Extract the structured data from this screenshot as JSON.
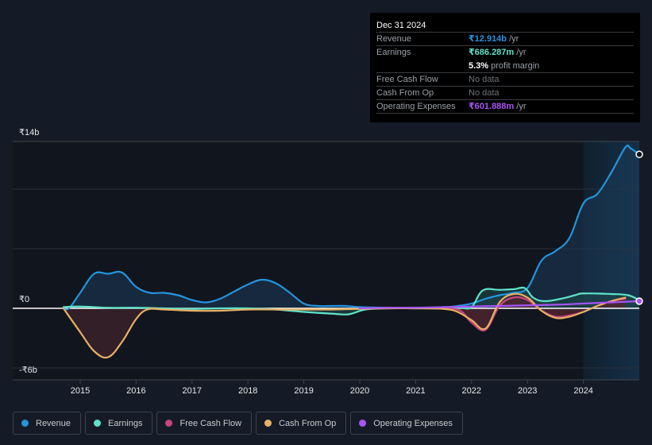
{
  "tooltip": {
    "date": "Dec 31 2024",
    "rows": [
      {
        "label": "Revenue",
        "value": "₹12.914b",
        "unit": " /yr",
        "color": "#2394df"
      },
      {
        "label": "Earnings",
        "value": "₹686.287m",
        "unit": " /yr",
        "color": "#5ee2c9"
      },
      {
        "label": "",
        "margin_value": "5.3%",
        "margin_text": " profit margin"
      },
      {
        "label": "Free Cash Flow",
        "value": "No data"
      },
      {
        "label": "Cash From Op",
        "value": "No data"
      },
      {
        "label": "Operating Expenses",
        "value": "₹601.888m",
        "unit": " /yr",
        "color": "#a855f7"
      }
    ]
  },
  "legend": [
    {
      "label": "Revenue",
      "color": "#2394df"
    },
    {
      "label": "Earnings",
      "color": "#5ee2c9"
    },
    {
      "label": "Free Cash Flow",
      "color": "#c7457f"
    },
    {
      "label": "Cash From Op",
      "color": "#e8b064"
    },
    {
      "label": "Operating Expenses",
      "color": "#a855f7"
    }
  ],
  "chart_data": {
    "type": "area",
    "title": "",
    "xlabel": "",
    "ylabel": "",
    "currency": "₹",
    "ylim": [
      -6,
      14
    ],
    "y_unit": "b",
    "y_tick_labels": [
      "₹14b",
      "₹0",
      "-₹6b"
    ],
    "x_tick_labels": [
      "2015",
      "2016",
      "2017",
      "2018",
      "2019",
      "2020",
      "2021",
      "2022",
      "2023",
      "2024"
    ],
    "xlim": [
      2014.2,
      2025.0
    ],
    "highlight_from": 2024.0,
    "grid": true,
    "legend_position": "bottom",
    "series": [
      {
        "name": "Revenue",
        "color": "#2394df",
        "points": [
          [
            2014.7,
            0.0
          ],
          [
            2014.8,
            0.0
          ],
          [
            2015.0,
            1.3
          ],
          [
            2015.25,
            2.9
          ],
          [
            2015.5,
            2.9
          ],
          [
            2015.75,
            3.0
          ],
          [
            2016.0,
            1.8
          ],
          [
            2016.25,
            1.3
          ],
          [
            2016.5,
            1.3
          ],
          [
            2016.75,
            1.1
          ],
          [
            2017.0,
            0.7
          ],
          [
            2017.25,
            0.5
          ],
          [
            2017.5,
            0.8
          ],
          [
            2017.75,
            1.4
          ],
          [
            2018.0,
            2.0
          ],
          [
            2018.25,
            2.4
          ],
          [
            2018.5,
            2.1
          ],
          [
            2018.75,
            1.3
          ],
          [
            2019.0,
            0.4
          ],
          [
            2019.25,
            0.2
          ],
          [
            2019.5,
            0.2
          ],
          [
            2019.75,
            0.2
          ],
          [
            2020.0,
            0.1
          ],
          [
            2020.5,
            0.05
          ],
          [
            2021.0,
            0.05
          ],
          [
            2021.5,
            0.1
          ],
          [
            2021.75,
            0.2
          ],
          [
            2022.0,
            0.4
          ],
          [
            2022.25,
            0.8
          ],
          [
            2022.5,
            1.1
          ],
          [
            2022.75,
            1.3
          ],
          [
            2023.0,
            1.7
          ],
          [
            2023.25,
            4.0
          ],
          [
            2023.5,
            4.8
          ],
          [
            2023.75,
            5.9
          ],
          [
            2024.0,
            8.8
          ],
          [
            2024.25,
            9.6
          ],
          [
            2024.5,
            11.4
          ],
          [
            2024.75,
            13.5
          ],
          [
            2024.85,
            13.4
          ],
          [
            2025.0,
            12.914
          ]
        ]
      },
      {
        "name": "Earnings",
        "color": "#5ee2c9",
        "points": [
          [
            2014.7,
            0.1
          ],
          [
            2015.0,
            0.15
          ],
          [
            2015.5,
            0.05
          ],
          [
            2016.0,
            0.05
          ],
          [
            2016.5,
            0.0
          ],
          [
            2017.0,
            -0.05
          ],
          [
            2017.5,
            0.0
          ],
          [
            2018.0,
            0.0
          ],
          [
            2018.5,
            -0.1
          ],
          [
            2019.0,
            -0.3
          ],
          [
            2019.5,
            -0.45
          ],
          [
            2019.8,
            -0.5
          ],
          [
            2020.1,
            -0.1
          ],
          [
            2020.5,
            0.0
          ],
          [
            2021.0,
            0.0
          ],
          [
            2021.5,
            0.0
          ],
          [
            2021.8,
            0.05
          ],
          [
            2022.0,
            0.1
          ],
          [
            2022.2,
            1.5
          ],
          [
            2022.5,
            1.55
          ],
          [
            2022.75,
            1.6
          ],
          [
            2022.95,
            1.7
          ],
          [
            2023.1,
            0.9
          ],
          [
            2023.3,
            0.6
          ],
          [
            2023.6,
            0.8
          ],
          [
            2023.85,
            1.1
          ],
          [
            2024.0,
            1.25
          ],
          [
            2024.5,
            1.2
          ],
          [
            2024.8,
            1.1
          ],
          [
            2025.0,
            0.686
          ]
        ]
      },
      {
        "name": "Free Cash Flow",
        "color": "#c7457f",
        "points": [
          [
            2021.5,
            0.0
          ],
          [
            2021.8,
            -0.2
          ],
          [
            2022.0,
            -1.2
          ],
          [
            2022.25,
            -1.8
          ],
          [
            2022.5,
            0.2
          ],
          [
            2022.75,
            0.9
          ],
          [
            2023.0,
            0.7
          ],
          [
            2023.25,
            -0.2
          ],
          [
            2023.5,
            -0.7
          ],
          [
            2023.75,
            -0.6
          ],
          [
            2024.0,
            -0.3
          ],
          [
            2024.25,
            0.2
          ],
          [
            2024.5,
            0.6
          ],
          [
            2024.75,
            0.8
          ]
        ]
      },
      {
        "name": "Cash From Op",
        "color": "#e8b064",
        "points": [
          [
            2014.7,
            0.0
          ],
          [
            2015.0,
            -2.0
          ],
          [
            2015.25,
            -3.6
          ],
          [
            2015.5,
            -4.1
          ],
          [
            2015.75,
            -2.8
          ],
          [
            2016.0,
            -0.9
          ],
          [
            2016.2,
            -0.1
          ],
          [
            2016.5,
            -0.1
          ],
          [
            2017.0,
            -0.2
          ],
          [
            2017.5,
            -0.2
          ],
          [
            2018.0,
            -0.1
          ],
          [
            2018.5,
            -0.1
          ],
          [
            2019.0,
            -0.1
          ],
          [
            2019.5,
            -0.1
          ],
          [
            2020.0,
            -0.05
          ],
          [
            2020.5,
            0.0
          ],
          [
            2021.0,
            0.0
          ],
          [
            2021.5,
            -0.05
          ],
          [
            2021.75,
            -0.3
          ],
          [
            2022.0,
            -1.0
          ],
          [
            2022.25,
            -1.7
          ],
          [
            2022.5,
            0.5
          ],
          [
            2022.75,
            1.2
          ],
          [
            2023.0,
            0.9
          ],
          [
            2023.25,
            -0.2
          ],
          [
            2023.5,
            -0.8
          ],
          [
            2023.75,
            -0.7
          ],
          [
            2024.0,
            -0.3
          ],
          [
            2024.25,
            0.2
          ],
          [
            2024.5,
            0.6
          ],
          [
            2024.75,
            0.9
          ]
        ]
      },
      {
        "name": "Operating Expenses",
        "color": "#a855f7",
        "points": [
          [
            2020.0,
            0.0
          ],
          [
            2020.5,
            0.05
          ],
          [
            2021.0,
            0.05
          ],
          [
            2021.5,
            0.1
          ],
          [
            2022.0,
            0.15
          ],
          [
            2022.5,
            0.2
          ],
          [
            2023.0,
            0.25
          ],
          [
            2023.5,
            0.3
          ],
          [
            2024.0,
            0.4
          ],
          [
            2024.5,
            0.5
          ],
          [
            2025.0,
            0.602
          ]
        ]
      }
    ]
  }
}
